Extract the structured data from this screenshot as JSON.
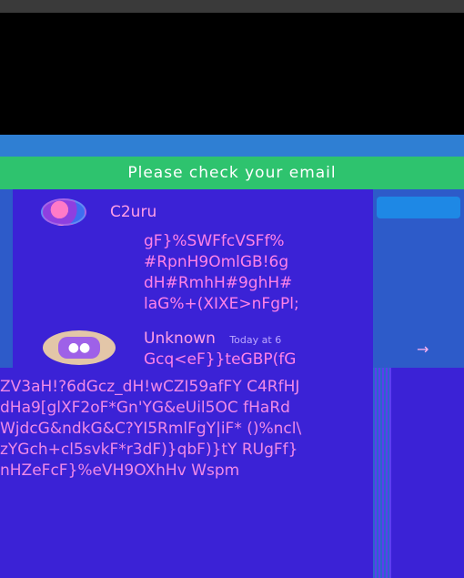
{
  "banner": {
    "text": "Please check your email"
  },
  "channel_user": {
    "name": "C2uru"
  },
  "message_lines": [
    "gF}%SWFfcVSFf%",
    "#RpnH9OmlGB!6g",
    "dH#RmhH#9ghH#",
    "laG%+(XIXE>nFgPl;"
  ],
  "message2": {
    "author": "Unknown",
    "timestamp": "Today at 6",
    "text": "Gcq<eF}}teGBP(fG"
  },
  "arrow_icon": "arrow-right-icon",
  "wide_lines": [
    "ZV3aH!?6dGcz_dH!wCZI59afFY  C4RfHJ",
    "dHa9[glXF2oF*Gn'YG&eUil5OC  fHaRd",
    "WjdcG&ndkG&C?YI5RmlFgY|iF*  ()%ncl\\",
    "zYGch+cl5svkF*r3dF)}qbF)}tY  RUgFf}",
    "nHZeFcF}%eVH9OXhHv            Wspm"
  ]
}
